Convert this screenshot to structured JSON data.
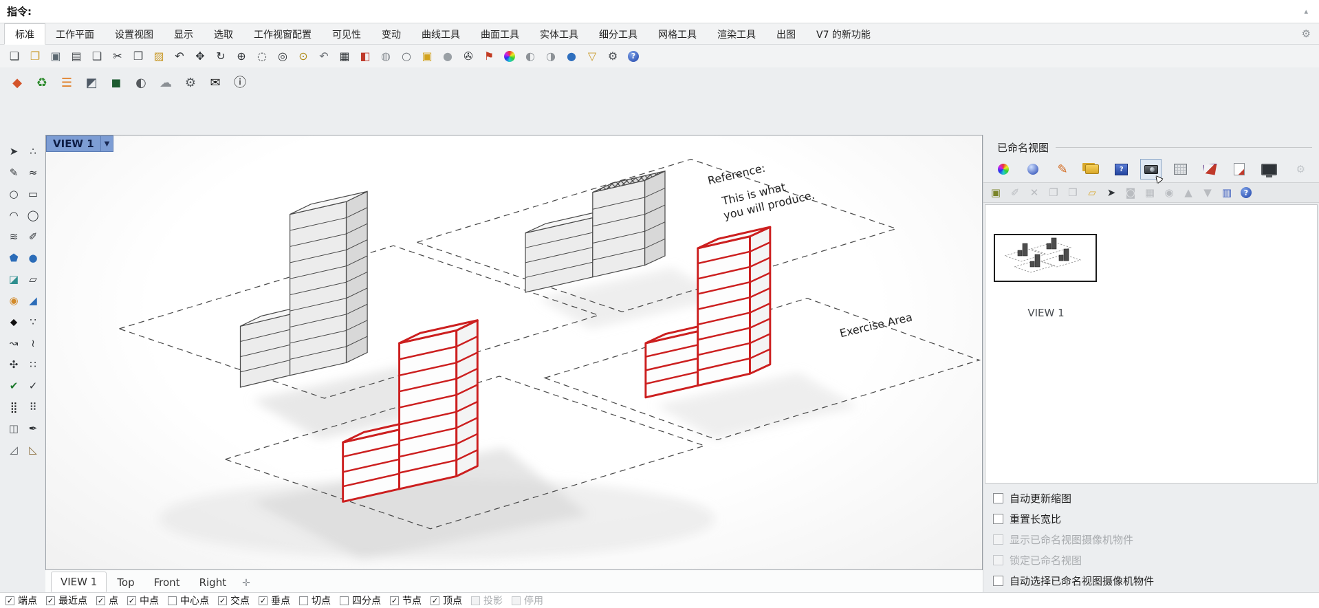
{
  "window": {
    "command_label": "指令:"
  },
  "menu_tabs": {
    "items": [
      {
        "label": "标准",
        "active": true
      },
      {
        "label": "工作平面"
      },
      {
        "label": "设置视图"
      },
      {
        "label": "显示"
      },
      {
        "label": "选取"
      },
      {
        "label": "工作视窗配置"
      },
      {
        "label": "可见性"
      },
      {
        "label": "变动"
      },
      {
        "label": "曲线工具"
      },
      {
        "label": "曲面工具"
      },
      {
        "label": "实体工具"
      },
      {
        "label": "细分工具"
      },
      {
        "label": "网格工具"
      },
      {
        "label": "渲染工具"
      },
      {
        "label": "出图"
      },
      {
        "label": "V7 的新功能"
      }
    ]
  },
  "toolbar_main": {
    "icons": [
      {
        "name": "new-file-icon",
        "glyph": "❏",
        "color": "#3c4043"
      },
      {
        "name": "open-file-icon",
        "glyph": "❐",
        "color": "#c99a2a"
      },
      {
        "name": "save-icon",
        "glyph": "▣",
        "color": "#5b6770"
      },
      {
        "name": "print-icon",
        "glyph": "▤",
        "color": "#4a4e52"
      },
      {
        "name": "export-icon",
        "glyph": "❑",
        "color": "#4a4e52"
      },
      {
        "name": "cut-icon",
        "glyph": "✂",
        "color": "#2f3337"
      },
      {
        "name": "copy-icon",
        "glyph": "❒",
        "color": "#4a4e52"
      },
      {
        "name": "paste-icon",
        "glyph": "▨",
        "color": "#c99a2a"
      },
      {
        "name": "undo-icon",
        "glyph": "↶",
        "color": "#2f3337"
      },
      {
        "name": "pan-hand-icon",
        "glyph": "✥",
        "color": "#2f3337"
      },
      {
        "name": "rotate-view-icon",
        "glyph": "↻",
        "color": "#2f3337"
      },
      {
        "name": "zoom-dynamic-icon",
        "glyph": "⊕",
        "color": "#2f3337"
      },
      {
        "name": "zoom-window-icon",
        "glyph": "◌",
        "color": "#2f3337"
      },
      {
        "name": "zoom-selected-icon",
        "glyph": "◎",
        "color": "#2f3337"
      },
      {
        "name": "zoom-extents-icon",
        "glyph": "⊙",
        "color": "#b08d1e"
      },
      {
        "name": "undo-view-icon",
        "glyph": "↶",
        "color": "#6b7075"
      },
      {
        "name": "viewport-layout-icon",
        "glyph": "▦",
        "color": "#2f3337"
      },
      {
        "name": "walkabout-icon",
        "glyph": "◧",
        "color": "#bf3a2b"
      },
      {
        "name": "ghosted-display-icon",
        "glyph": "◍",
        "color": "#8d9297"
      },
      {
        "name": "wireframe-display-icon",
        "glyph": "○",
        "color": "#6b7075"
      },
      {
        "name": "layer-state-icon",
        "glyph": "▣",
        "color": "#d2a21c"
      },
      {
        "name": "shaded-display-icon",
        "glyph": "●",
        "color": "#9aa0a5"
      },
      {
        "name": "lock-icon",
        "glyph": "✇",
        "color": "#2f3337"
      },
      {
        "name": "flag-icon",
        "glyph": "⚑",
        "color": "#c23b22"
      },
      {
        "name": "color-wheel-icon",
        "glyph": "",
        "cls": "ic-cw-sm"
      },
      {
        "name": "render-preview-icon",
        "glyph": "◐",
        "color": "#8d9297"
      },
      {
        "name": "render-preview-alt-icon",
        "glyph": "◑",
        "color": "#8d9297"
      },
      {
        "name": "earth-icon",
        "glyph": "●",
        "color": "#2f6fbe"
      },
      {
        "name": "filter-icon",
        "glyph": "▽",
        "color": "#c99a2a"
      },
      {
        "name": "options-globe-icon",
        "glyph": "⚙",
        "color": "#4a4e52"
      },
      {
        "name": "help-icon",
        "glyph": "",
        "cls": "ic-help"
      }
    ]
  },
  "toolbar_secondary": {
    "icons": [
      {
        "name": "vray-icon",
        "glyph": "◆",
        "color": "#d4542a"
      },
      {
        "name": "refresh-icon",
        "glyph": "♻",
        "color": "#2e8b2e"
      },
      {
        "name": "task-list-icon",
        "glyph": "☰",
        "color": "#e07b20"
      },
      {
        "name": "snapshot-icon",
        "glyph": "◩",
        "color": "#4f5a66"
      },
      {
        "name": "package-icon",
        "glyph": "◼",
        "color": "#1e5c31"
      },
      {
        "name": "material-checker-icon",
        "glyph": "◐",
        "color": "#55595d"
      },
      {
        "name": "cloud-icon",
        "glyph": "☁",
        "color": "#8a8f94"
      },
      {
        "name": "settings-gear-icon",
        "glyph": "⚙",
        "color": "#55595d"
      },
      {
        "name": "mail-icon",
        "glyph": "✉",
        "color": "#1a1a1a"
      },
      {
        "name": "info-icon",
        "glyph": "ⓘ",
        "color": "#1a1a1a"
      }
    ]
  },
  "sidebar": {
    "tools": [
      {
        "name": "select-arrow-icon",
        "glyph": "➤",
        "color": "#2f3337"
      },
      {
        "name": "point-tool-icon",
        "glyph": "∴",
        "color": "#2f3337"
      },
      {
        "name": "polyline-tool-icon",
        "glyph": "✎",
        "color": "#2f3337"
      },
      {
        "name": "freeform-curve-icon",
        "glyph": "≈",
        "color": "#2f3337"
      },
      {
        "name": "circle-tool-icon",
        "glyph": "○",
        "color": "#2f3337"
      },
      {
        "name": "rectangle-tool-icon",
        "glyph": "▭",
        "color": "#2f3337"
      },
      {
        "name": "arc-tool-icon",
        "glyph": "◠",
        "color": "#2f3337"
      },
      {
        "name": "ellipse-tool-icon",
        "glyph": "◯",
        "color": "#2f3337"
      },
      {
        "name": "offset-tool-icon",
        "glyph": "≋",
        "color": "#2f3337"
      },
      {
        "name": "brush-tool-icon",
        "glyph": "✐",
        "color": "#2f3337"
      },
      {
        "name": "solid-cylinder-icon",
        "glyph": "⬟",
        "color": "#2b6cb8"
      },
      {
        "name": "sphere-tool-icon",
        "glyph": "●",
        "color": "#2b6cb8"
      },
      {
        "name": "surface-tool-icon",
        "glyph": "◪",
        "color": "#2f8f8f"
      },
      {
        "name": "loft-tool-icon",
        "glyph": "▱",
        "color": "#2f3337"
      },
      {
        "name": "gumball-tool-icon",
        "glyph": "◉",
        "color": "#d28a2a"
      },
      {
        "name": "tilt-tool-icon",
        "glyph": "◢",
        "color": "#2b6cb8"
      },
      {
        "name": "drop-tool-icon",
        "glyph": "⬥",
        "color": "#111111"
      },
      {
        "name": "dot-annotation-icon",
        "glyph": "∵",
        "color": "#2f3337"
      },
      {
        "name": "curve-arrow-icon",
        "glyph": "↝",
        "color": "#2f3337"
      },
      {
        "name": "handle-tool-icon",
        "glyph": "≀",
        "color": "#2f3337"
      },
      {
        "name": "tree-tool-icon",
        "glyph": "✣",
        "color": "#2f3337"
      },
      {
        "name": "array-dots-icon",
        "glyph": "∷",
        "color": "#2f3337"
      },
      {
        "name": "check-tool-icon",
        "glyph": "✔",
        "color": "#1f7a2f"
      },
      {
        "name": "clipboard-check-icon",
        "glyph": "✓",
        "color": "#2f3337"
      },
      {
        "name": "grid-array-icon",
        "glyph": "⣿",
        "color": "#111111"
      },
      {
        "name": "list-dots-icon",
        "glyph": "⠿",
        "color": "#2f3337"
      },
      {
        "name": "mirror-tool-icon",
        "glyph": "◫",
        "color": "#55595d"
      },
      {
        "name": "pen-check-icon",
        "glyph": "✒",
        "color": "#2f3337"
      },
      {
        "name": "chamfer-tool-icon",
        "glyph": "◿",
        "color": "#55595d"
      },
      {
        "name": "slope-tool-icon",
        "glyph": "◺",
        "color": "#8a6d3b"
      }
    ]
  },
  "viewport": {
    "title": "VIEW 1",
    "annotations": {
      "reference_line1": "Reference:",
      "reference_line2": "This is what",
      "reference_line3": "you will produce.",
      "exercise_area": "Exercise Area"
    },
    "tabs": [
      {
        "label": "VIEW 1",
        "active": true
      },
      {
        "label": "Top"
      },
      {
        "label": "Front"
      },
      {
        "label": "Right"
      }
    ]
  },
  "named_views_panel": {
    "title": "已命名视图",
    "tabs": [
      {
        "name": "color-wheel-tab-icon",
        "cls": "ic-cw",
        "glyph": ""
      },
      {
        "name": "render-bomb-tab-icon",
        "cls": "ic-bomb",
        "glyph": ""
      },
      {
        "name": "annotate-pencil-tab-icon",
        "cls": "ic-pencil",
        "glyph": "✎"
      },
      {
        "name": "folder-tab-icon",
        "cls": "ic-folder",
        "glyph": ""
      },
      {
        "name": "display-properties-tab-icon",
        "cls": "ic-dispq",
        "glyph": ""
      },
      {
        "name": "named-views-camera-tab-icon",
        "cls": "ic-camera has-cursor",
        "glyph": "",
        "active": true
      },
      {
        "name": "grid-table-tab-icon",
        "cls": "ic-grid",
        "glyph": ""
      },
      {
        "name": "layers-wedge-tab-icon",
        "cls": "ic-wedge",
        "glyph": ""
      },
      {
        "name": "notes-tab-icon",
        "cls": "ic-note",
        "glyph": ""
      },
      {
        "name": "monitor-tab-icon",
        "cls": "ic-monitor",
        "glyph": ""
      }
    ],
    "toolbar": [
      {
        "name": "save-view-icon",
        "glyph": "▣",
        "color": "#7a8428"
      },
      {
        "name": "edit-view-icon",
        "glyph": "✐",
        "enabled": false
      },
      {
        "name": "delete-view-icon",
        "glyph": "✕",
        "enabled": false
      },
      {
        "name": "copy-view-icon",
        "glyph": "❐",
        "enabled": false
      },
      {
        "name": "duplicate-view-icon",
        "glyph": "❒",
        "enabled": false
      },
      {
        "name": "import-views-folder-icon",
        "glyph": "▱",
        "color": "#d8a92f"
      },
      {
        "name": "select-view-cursor-icon",
        "glyph": "➤",
        "color": "#2f3337"
      },
      {
        "name": "camera-view-icon",
        "glyph": "◙",
        "enabled": false
      },
      {
        "name": "stack-views-icon",
        "glyph": "▦",
        "enabled": false
      },
      {
        "name": "show-view-eye-icon",
        "glyph": "◉",
        "enabled": false
      },
      {
        "name": "move-up-icon",
        "glyph": "▲",
        "enabled": false
      },
      {
        "name": "move-down-icon",
        "glyph": "▼",
        "enabled": false
      },
      {
        "name": "thumbnail-mode-icon",
        "glyph": "▥",
        "color": "#3a5bbf"
      },
      {
        "name": "panel-help-icon",
        "glyph": "",
        "cls": "ic-help"
      }
    ],
    "views": [
      {
        "name": "VIEW 1"
      }
    ],
    "checkboxes": [
      {
        "label": "自动更新缩图",
        "checked": false,
        "enabled": true
      },
      {
        "label": "重置长宽比",
        "checked": false,
        "enabled": true
      },
      {
        "label": "显示已命名视图摄像机物件",
        "checked": false,
        "enabled": false
      },
      {
        "label": "锁定已命名视图",
        "checked": false,
        "enabled": false
      },
      {
        "label": "自动选择已命名视图摄像机物件",
        "checked": false,
        "enabled": true
      }
    ]
  },
  "status_bar": {
    "osnaps": [
      {
        "label": "端点",
        "checked": true,
        "enabled": true
      },
      {
        "label": "最近点",
        "checked": true,
        "enabled": true
      },
      {
        "label": "点",
        "checked": true,
        "enabled": true
      },
      {
        "label": "中点",
        "checked": true,
        "enabled": true
      },
      {
        "label": "中心点",
        "checked": false,
        "enabled": true
      },
      {
        "label": "交点",
        "checked": true,
        "enabled": true
      },
      {
        "label": "垂点",
        "checked": true,
        "enabled": true
      },
      {
        "label": "切点",
        "checked": false,
        "enabled": true
      },
      {
        "label": "四分点",
        "checked": false,
        "enabled": true
      },
      {
        "label": "节点",
        "checked": true,
        "enabled": true
      },
      {
        "label": "顶点",
        "checked": true,
        "enabled": true
      },
      {
        "label": "投影",
        "checked": false,
        "enabled": false
      },
      {
        "label": "停用",
        "checked": false,
        "enabled": false
      }
    ]
  }
}
